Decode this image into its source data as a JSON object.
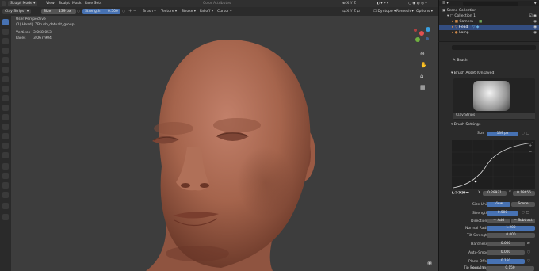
{
  "topbar": {
    "mode": "Sculpt Mode",
    "menus": [
      "View",
      "Sculpt",
      "Mask",
      "Face Sets"
    ],
    "color_attributes": "Color Attributes"
  },
  "toolheader": {
    "brush_name": "Clay Strips*",
    "size_label": "Size",
    "size_value": "139 px",
    "strength_label": "Strength",
    "strength_value": "0.500",
    "menus": [
      "Brush",
      "Texture",
      "Stroke",
      "Falloff",
      "Cursor"
    ],
    "dyntopo": "Dyntopo",
    "remesh": "Remesh",
    "options": "Options"
  },
  "viewport": {
    "view_name": "User Perspective",
    "object_info": "(1) Head | ZBrush_defualt_group",
    "stats": [
      {
        "label": "Vertices",
        "value": "3,068,053"
      },
      {
        "label": "Faces",
        "value": "3,067,904"
      }
    ]
  },
  "outliner": {
    "rows": [
      {
        "label": "Scene Collection",
        "indent": 0
      },
      {
        "label": "Collection 1",
        "indent": 1
      },
      {
        "label": "Camera",
        "indent": 2
      },
      {
        "label": "Head",
        "indent": 2
      },
      {
        "label": "Lamp",
        "indent": 2
      }
    ]
  },
  "properties": {
    "brush_header": "Brush",
    "brush_asset": "Brush Asset (Unsaved)",
    "brush_preview_name": "Clay Strips",
    "brush_settings": "Brush Settings",
    "size_label": "Size",
    "size_value": "139 px",
    "curve_x_label": "X",
    "curve_x_value": "0.28971",
    "curve_y_label": "Y",
    "curve_y_value": "0.18656",
    "size_unit_label": "Size Unit",
    "size_unit_options": [
      "View",
      "Scene"
    ],
    "strength_label": "Strength",
    "strength_value": "0.500",
    "direction_label": "Direction",
    "direction_options": [
      "Add",
      "Subtract"
    ],
    "normal_radius_label": "Normal Radius",
    "normal_radius_value": "1.200",
    "tilt_strength_label": "Tilt Strength",
    "tilt_strength_value": "0.000",
    "hardness_label": "Hardness",
    "hardness_value": "0.000",
    "auto_smooth_label": "Auto-Smooth",
    "auto_smooth_value": "0.000",
    "plane_offset_label": "Plane Offset",
    "plane_offset_value": "0.150",
    "plane_trim_label": "Plane Trim",
    "tip_roundness_label": "Tip Roundness",
    "tip_roundness_value": "0.150"
  },
  "colors": {
    "accent": "#4772b3",
    "viewport_bg": "#3d3d3d",
    "skin": "#a8684f"
  }
}
